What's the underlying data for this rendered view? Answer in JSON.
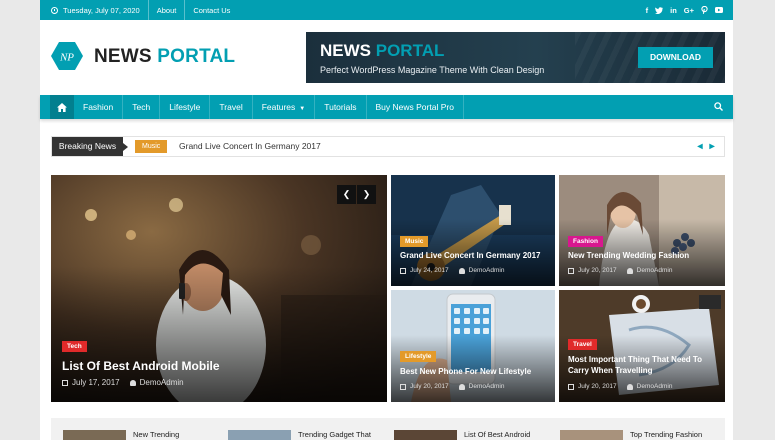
{
  "topbar": {
    "date": "Tuesday, July 07, 2020",
    "links": [
      "About",
      "Contact Us"
    ],
    "social_icons": [
      "facebook-icon",
      "twitter-icon",
      "linkedin-icon",
      "google-plus-icon",
      "pinterest-icon",
      "youtube-icon"
    ]
  },
  "logo": {
    "mark": "NP",
    "name_part1": "NEWS",
    "name_part2": "PORTAL"
  },
  "banner": {
    "title_part1": "NEWS",
    "title_part2": "PORTAL",
    "subtitle": "Perfect  WordPress Magazine Theme With Clean Design",
    "button": "DOWNLOAD"
  },
  "nav": {
    "items": [
      "Fashion",
      "Tech",
      "Lifestyle",
      "Travel",
      "Features",
      "Tutorials",
      "Buy News Portal Pro"
    ]
  },
  "ticker": {
    "label": "Breaking News",
    "category": "Music",
    "headline": "Grand Live Concert In Germany 2017"
  },
  "featured": {
    "category": "Tech",
    "title": "List Of Best Android Mobile",
    "date": "July 17, 2017",
    "author": "DemoAdmin"
  },
  "grid": [
    {
      "category": "Music",
      "title": "Grand Live Concert In Germany 2017",
      "date": "July 24, 2017",
      "author": "DemoAdmin"
    },
    {
      "category": "Fashion",
      "title": "New Trending Wedding Fashion",
      "date": "July 20, 2017",
      "author": "DemoAdmin"
    },
    {
      "category": "Lifestyle",
      "title": "Best New Phone For New Lifestyle",
      "date": "July 20, 2017",
      "author": "DemoAdmin"
    },
    {
      "category": "Travel",
      "title": "Most Important Thing That Need To Carry When Travelling",
      "date": "July 20, 2017",
      "author": "DemoAdmin"
    }
  ],
  "bottom": [
    "New Trending",
    "Trending Gadget That",
    "List Of Best Android",
    "Top Trending Fashion"
  ],
  "colors": {
    "accent": "#029fb2",
    "music": "#e39a2a",
    "fashion": "#d8178f",
    "lifestyle": "#e39a2a",
    "travel": "#e02a2a",
    "tech": "#e02a2a"
  }
}
